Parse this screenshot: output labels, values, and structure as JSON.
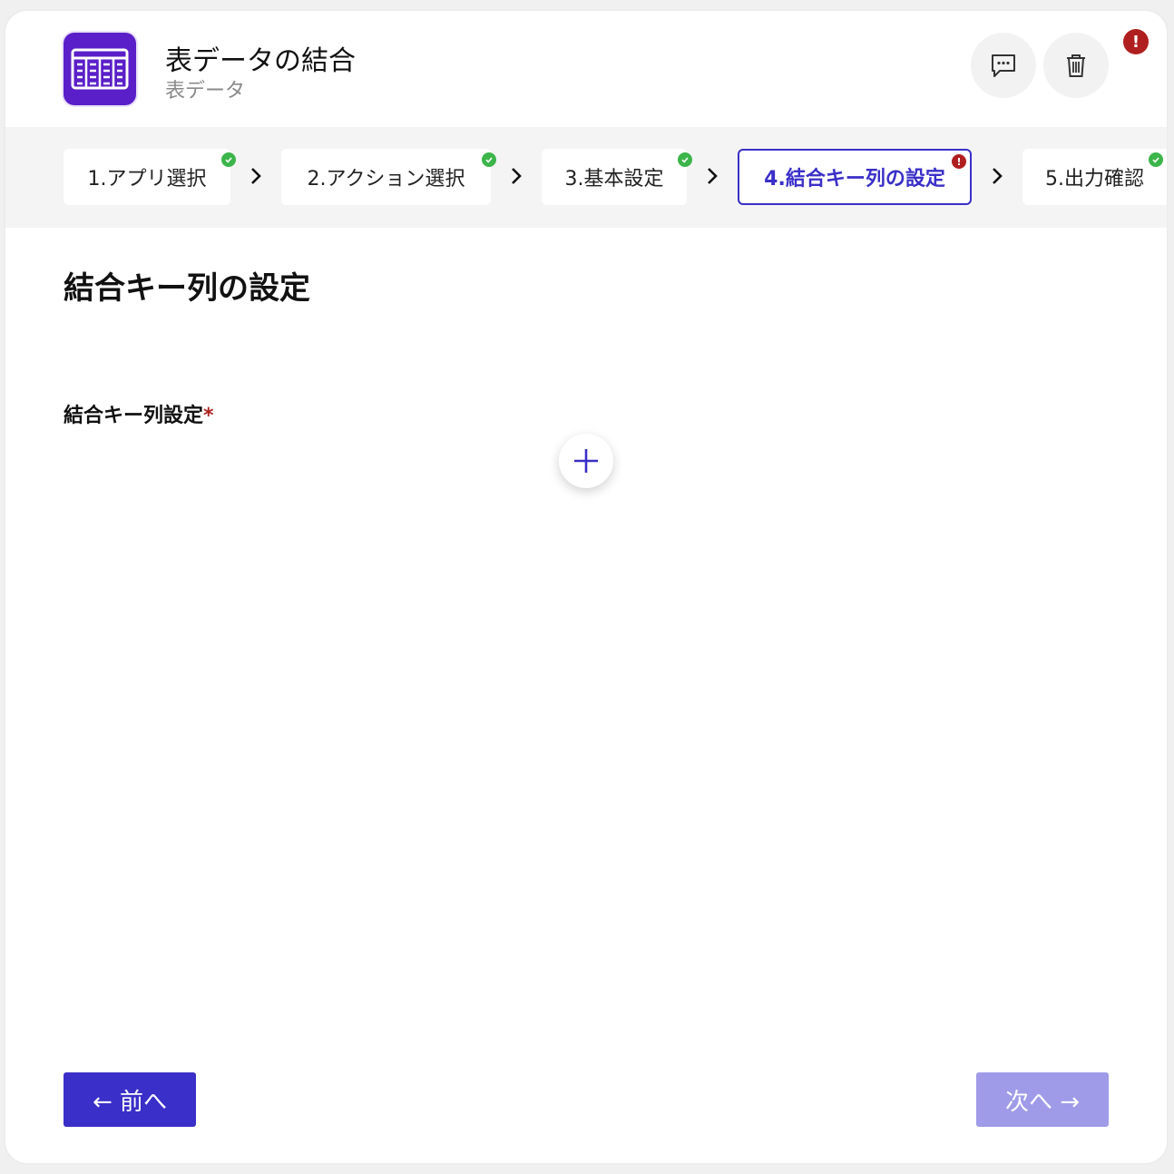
{
  "header": {
    "title": "表データの結合",
    "subtitle": "表データ",
    "alert_symbol": "!",
    "icons": {
      "app": "table-icon",
      "comment": "comment-icon",
      "trash": "trash-icon"
    }
  },
  "steps": [
    {
      "label": "1.アプリ選択",
      "status": "complete"
    },
    {
      "label": "2.アクション選択",
      "status": "complete"
    },
    {
      "label": "3.基本設定",
      "status": "complete"
    },
    {
      "label": "4.結合キー列の設定",
      "status": "error",
      "active": true,
      "badge": "!"
    },
    {
      "label": "5.出力確認",
      "status": "complete"
    }
  ],
  "main": {
    "section_title": "結合キー列の設定",
    "field_label": "結合キー列設定",
    "required_mark": "*"
  },
  "footer": {
    "prev_label": "← 前へ",
    "next_label": "次へ →"
  },
  "colors": {
    "brand": "#3a2fc8",
    "brand_disabled": "#9f9be8",
    "app_icon": "#5b1fc9",
    "success": "#3cb54a",
    "error": "#b01f1f"
  }
}
